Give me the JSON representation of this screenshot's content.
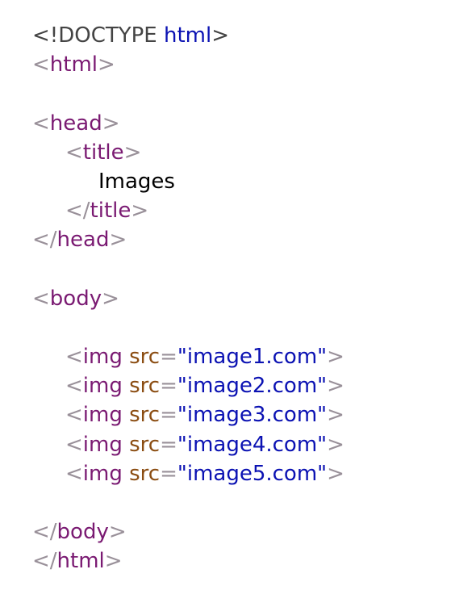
{
  "code": {
    "doctype_open": "<!DOCTYPE",
    "doctype_kw": " html",
    "doctype_close": ">",
    "tag_html": "html",
    "tag_head": "head",
    "tag_title": "title",
    "title_text": "Images",
    "tag_body": "body",
    "tag_img": "img",
    "attr_src": " src",
    "eq": "=",
    "lt": "<",
    "gt": ">",
    "lt_slash": "</",
    "images": [
      "\"image1.com\"",
      "\"image2.com\"",
      "\"image3.com\"",
      "\"image4.com\"",
      "\"image5.com\""
    ]
  },
  "colors": {
    "bracket": "#999099",
    "tag": "#7a1a72",
    "attr": "#8b4d12",
    "value": "#0b12b3",
    "text": "#000000",
    "doctype": "#444444"
  }
}
